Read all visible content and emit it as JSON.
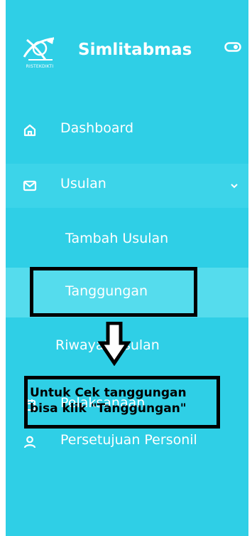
{
  "sidebar": {
    "brand": {
      "name": "Simlitabmas",
      "logo_caption": "RISTEKDIKTI"
    },
    "items": [
      {
        "label": "Dashboard",
        "icon": "home-icon"
      },
      {
        "label": "Usulan",
        "icon": "mail-icon",
        "expanded": true,
        "subitems": [
          {
            "label": "Tambah Usulan"
          },
          {
            "label": "Tanggungan",
            "highlighted": true
          },
          {
            "label": "Riwayat Usulan"
          }
        ]
      },
      {
        "label": "Pelaksanaan",
        "icon": "calendar-icon"
      },
      {
        "label": "Persetujuan Personil",
        "icon": "user-icon"
      }
    ]
  },
  "annotation": {
    "line1": "Untuk Cek tanggungan",
    "line2": "bisa klik \"Tanggungan\""
  },
  "colors": {
    "sidebar_bg": "#2fcfe6",
    "annotation": "#000000"
  }
}
